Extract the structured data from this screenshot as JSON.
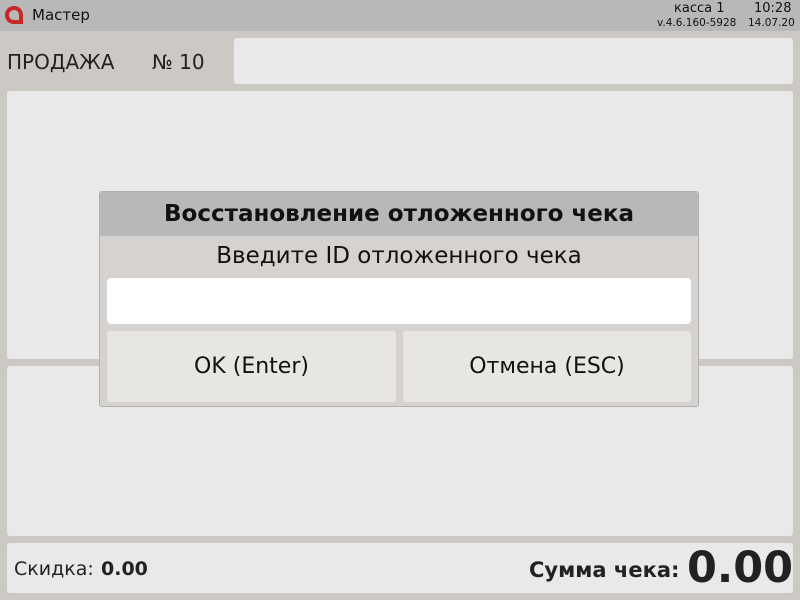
{
  "header": {
    "app_title": "Мастер",
    "register": "касса 1",
    "time": "10:28",
    "version": "v.4.6.160-5928",
    "date": "14.07.20",
    "logo_icon": "app-logo-icon",
    "brand_color": "#c62828"
  },
  "sale": {
    "label": "ПРОДАЖА",
    "number": "№ 10"
  },
  "dialog": {
    "title": "Восстановление отложенного чека",
    "prompt": "Введите ID отложенного чека",
    "input_value": "",
    "ok_label": "OK (Enter)",
    "cancel_label": "Отмена (ESC)"
  },
  "footer": {
    "discount_label": "Скидка:",
    "discount_value": "0.00",
    "total_label": "Сумма чека:",
    "total_value": "0.00"
  }
}
